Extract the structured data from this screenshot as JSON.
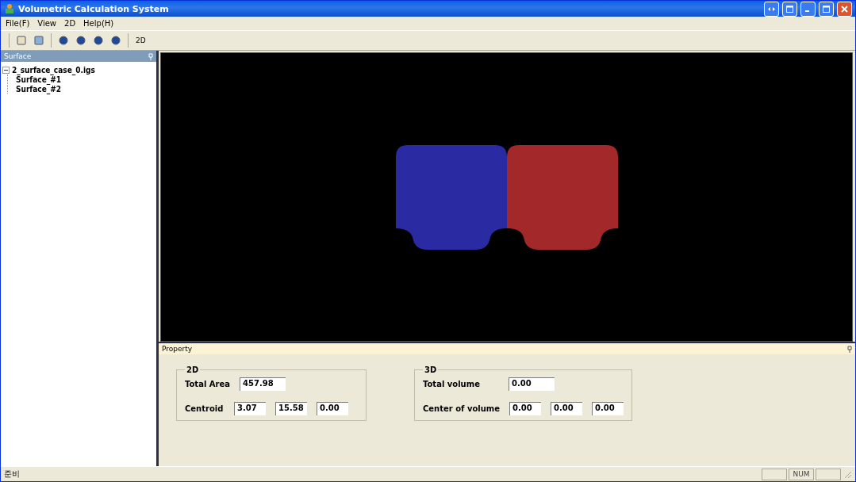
{
  "window": {
    "title": "Volumetric Calculation System"
  },
  "menu": [
    "File(F)",
    "View",
    "2D",
    "Help(H)"
  ],
  "toolbar": {
    "label_button": "2D"
  },
  "surface_panel": {
    "title": "Surface",
    "tree": [
      {
        "label": "2_surface_case_0.igs",
        "expanded": true,
        "children": [
          {
            "label": "Surface_#1"
          },
          {
            "label": "Surface_#2"
          }
        ]
      }
    ]
  },
  "property_panel": {
    "title": "Property",
    "groups": [
      {
        "title": "2D",
        "rows": [
          {
            "label": "Total Area",
            "values": [
              "457.98"
            ]
          },
          {
            "label": "Centroid",
            "values": [
              "3.07",
              "15.58",
              "0.00"
            ]
          }
        ]
      },
      {
        "title": "3D",
        "rows": [
          {
            "label": "Total volume",
            "values": [
              "0.00"
            ]
          },
          {
            "label": "Center of volume",
            "values": [
              "0.00",
              "0.00",
              "0.00"
            ]
          }
        ]
      }
    ]
  },
  "status_bar": {
    "message": "준비",
    "indicators": [
      "NUM"
    ]
  }
}
